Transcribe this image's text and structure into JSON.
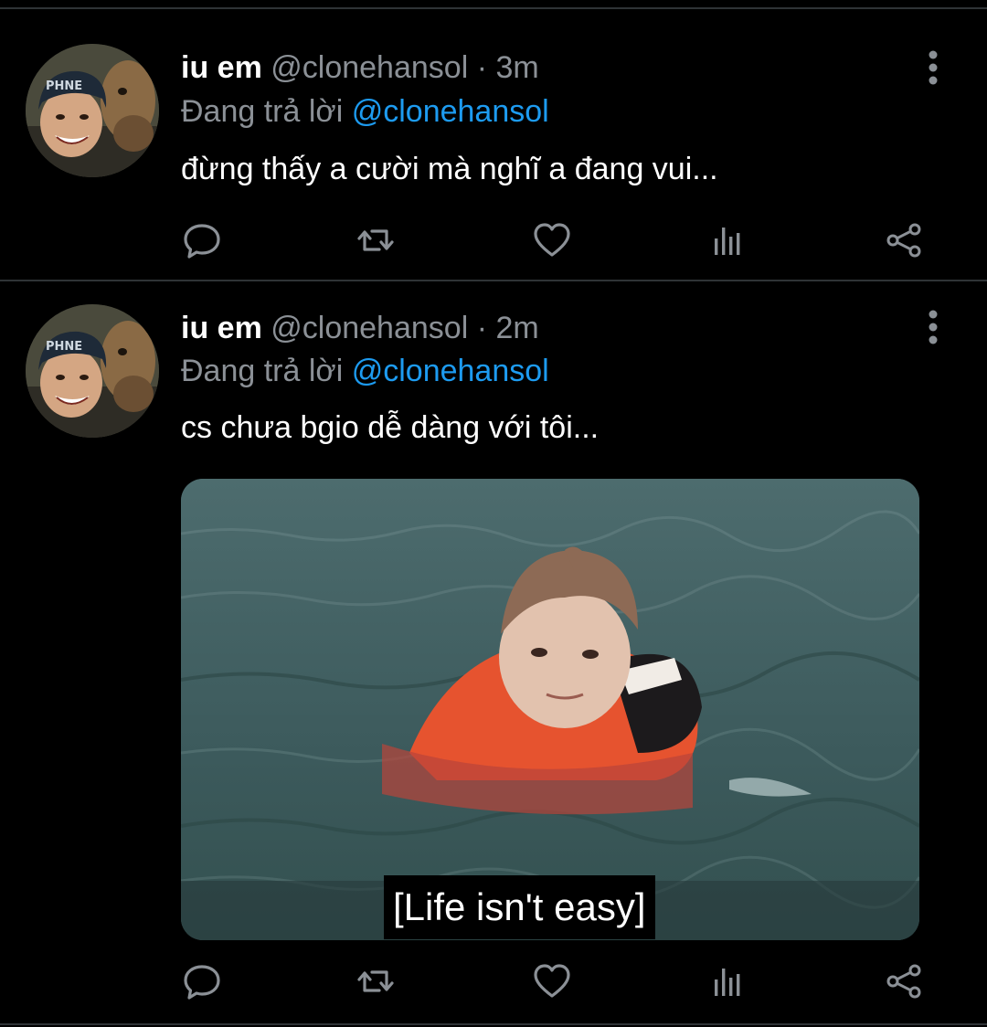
{
  "colors": {
    "background": "#000000",
    "divider": "#2f3336",
    "secondary_text": "#8b9096",
    "link": "#1d9bf0"
  },
  "tweets": [
    {
      "display_name": "iu em",
      "handle": "@clonehansol",
      "separator": "·",
      "time": "3m",
      "reply_prefix": "Đang trả lời",
      "reply_handle": "@clonehansol",
      "text": "đừng thấy a cười mà nghĩ a đang vui...",
      "avatar_icon": "profile-photo",
      "more_icon": "vertical-dots-icon"
    },
    {
      "display_name": "iu em",
      "handle": "@clonehansol",
      "separator": "·",
      "time": "2m",
      "reply_prefix": "Đang trả lời",
      "reply_handle": "@clonehansol",
      "text": "cs chưa bgio dễ dàng với tôi...",
      "avatar_icon": "profile-photo",
      "more_icon": "vertical-dots-icon",
      "media": {
        "caption": "[Life isn't easy]"
      }
    }
  ],
  "actions": [
    "reply-icon",
    "retweet-icon",
    "like-icon",
    "stats-icon",
    "share-icon"
  ]
}
